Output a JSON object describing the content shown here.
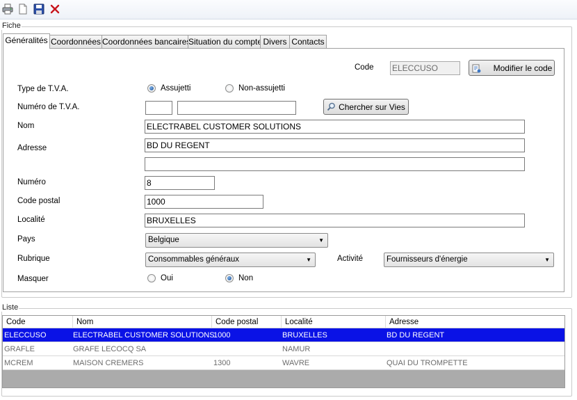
{
  "toolbar": {
    "icons": [
      "print-icon",
      "new-document-icon",
      "save-icon",
      "delete-icon"
    ]
  },
  "fiche": {
    "group_label": "Fiche",
    "tabs": [
      {
        "label": "Généralités",
        "active": true
      },
      {
        "label": "Coordonnées"
      },
      {
        "label": "Coordonnées bancaires"
      },
      {
        "label": "Situation du compte"
      },
      {
        "label": "Divers"
      },
      {
        "label": "Contacts"
      }
    ],
    "code_label": "Code",
    "code_value": "ELECCUSO",
    "modify_code_button": "Modifier le code",
    "tva_type_label": "Type de T.V.A.",
    "tva_option_1": "Assujetti",
    "tva_option_2": "Non-assujetti",
    "tva_number_label": "Numéro de T.V.A.",
    "tva_prefix_value": "",
    "tva_number_value": "",
    "vies_button": "Chercher sur Vies",
    "name_label": "Nom",
    "name_value": "ELECTRABEL CUSTOMER SOLUTIONS",
    "address_label": "Adresse",
    "address_line_1": "BD DU REGENT",
    "address_line_2": "",
    "number_label": "Numéro",
    "number_value": "8",
    "postal_code_label": "Code postal",
    "postal_code_value": "1000",
    "locality_label": "Localité",
    "locality_value": "BRUXELLES",
    "country_label": "Pays",
    "country_value": "Belgique",
    "rubric_label": "Rubrique",
    "rubric_value": "Consommables généraux",
    "activity_label": "Activité",
    "activity_value": "Fournisseurs d'énergie",
    "hide_label": "Masquer",
    "hide_option_yes": "Oui",
    "hide_option_no": "Non"
  },
  "liste": {
    "group_label": "Liste",
    "columns": [
      "Code",
      "Nom",
      "Code postal",
      "Localité",
      "Adresse"
    ],
    "rows": [
      {
        "code": "ELECCUSO",
        "nom": "ELECTRABEL CUSTOMER SOLUTIONS",
        "cp": "1000",
        "localite": "BRUXELLES",
        "adresse": "BD DU REGENT"
      },
      {
        "code": "GRAFLE",
        "nom": "GRAFE LECOCQ  SA",
        "cp": "",
        "localite": "NAMUR",
        "adresse": ""
      },
      {
        "code": "MCREM",
        "nom": "MAISON CREMERS",
        "cp": "1300",
        "localite": "WAVRE",
        "adresse": "QUAI DU TROMPETTE"
      }
    ]
  }
}
